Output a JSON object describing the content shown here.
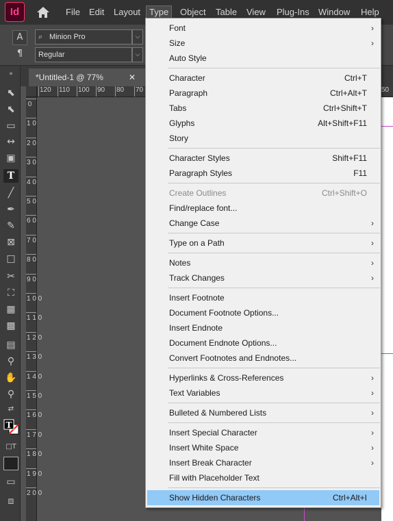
{
  "app": {
    "logo_text": "Id",
    "menus": [
      "File",
      "Edit",
      "Layout",
      "Type",
      "Object",
      "Table",
      "View",
      "Plug-Ins",
      "Window",
      "Help"
    ]
  },
  "controlbar": {
    "font_family": "Minion Pro",
    "font_style": "Regular",
    "char_button": "A",
    "para_button": "¶"
  },
  "document_tab": {
    "title": "*Untitled-1 @ 77%",
    "close": "✕"
  },
  "ruler_top_labels": [
    "120",
    "110",
    "100",
    "90",
    "80",
    "70",
    "50"
  ],
  "ruler_left_labels": [
    "0",
    "1 0",
    "2 0",
    "3 0",
    "4 0",
    "5 0",
    "6 0",
    "7 0",
    "8 0",
    "9 0",
    "1 0 0",
    "1 1 0",
    "1 2 0",
    "1 3 0",
    "1 4 0",
    "1 5 0",
    "1 6 0",
    "1 7 0",
    "1 8 0",
    "1 9 0",
    "2 0 0"
  ],
  "type_menu": {
    "items": [
      {
        "label": "Font",
        "shortcut": "",
        "submenu": true
      },
      {
        "label": "Size",
        "shortcut": "",
        "submenu": true
      },
      {
        "label": "Auto Style",
        "shortcut": "",
        "submenu": false
      },
      {
        "label": "Character",
        "shortcut": "Ctrl+T",
        "submenu": false
      },
      {
        "label": "Paragraph",
        "shortcut": "Ctrl+Alt+T",
        "submenu": false
      },
      {
        "label": "Tabs",
        "shortcut": "Ctrl+Shift+T",
        "submenu": false
      },
      {
        "label": "Glyphs",
        "shortcut": "Alt+Shift+F11",
        "submenu": false
      },
      {
        "label": "Story",
        "shortcut": "",
        "submenu": false
      },
      {
        "label": "Character Styles",
        "shortcut": "Shift+F11",
        "submenu": false
      },
      {
        "label": "Paragraph Styles",
        "shortcut": "F11",
        "submenu": false
      },
      {
        "label": "Create Outlines",
        "shortcut": "Ctrl+Shift+O",
        "submenu": false,
        "disabled": true
      },
      {
        "label": "Find/replace font...",
        "shortcut": "",
        "submenu": false
      },
      {
        "label": "Change Case",
        "shortcut": "",
        "submenu": true
      },
      {
        "label": "Type on a Path",
        "shortcut": "",
        "submenu": true
      },
      {
        "label": "Notes",
        "shortcut": "",
        "submenu": true
      },
      {
        "label": "Track Changes",
        "shortcut": "",
        "submenu": true
      },
      {
        "label": "Insert Footnote",
        "shortcut": "",
        "submenu": false
      },
      {
        "label": "Document Footnote Options...",
        "shortcut": "",
        "submenu": false
      },
      {
        "label": "Insert Endnote",
        "shortcut": "",
        "submenu": false
      },
      {
        "label": "Document Endnote Options...",
        "shortcut": "",
        "submenu": false
      },
      {
        "label": "Convert Footnotes and Endnotes...",
        "shortcut": "",
        "submenu": false
      },
      {
        "label": "Hyperlinks & Cross-References",
        "shortcut": "",
        "submenu": true
      },
      {
        "label": "Text Variables",
        "shortcut": "",
        "submenu": true
      },
      {
        "label": "Bulleted & Numbered Lists",
        "shortcut": "",
        "submenu": true
      },
      {
        "label": "Insert Special Character",
        "shortcut": "",
        "submenu": true
      },
      {
        "label": "Insert White Space",
        "shortcut": "",
        "submenu": true
      },
      {
        "label": "Insert Break Character",
        "shortcut": "",
        "submenu": true
      },
      {
        "label": "Fill with Placeholder Text",
        "shortcut": "",
        "submenu": false
      },
      {
        "label": "Show Hidden Characters",
        "shortcut": "Ctrl+Alt+I",
        "submenu": false,
        "highlighted": true
      }
    ]
  },
  "colors": {
    "menu_highlight": "#91c9f7",
    "app_accent": "#ff3366",
    "margin_magenta": "#c44cc4"
  }
}
